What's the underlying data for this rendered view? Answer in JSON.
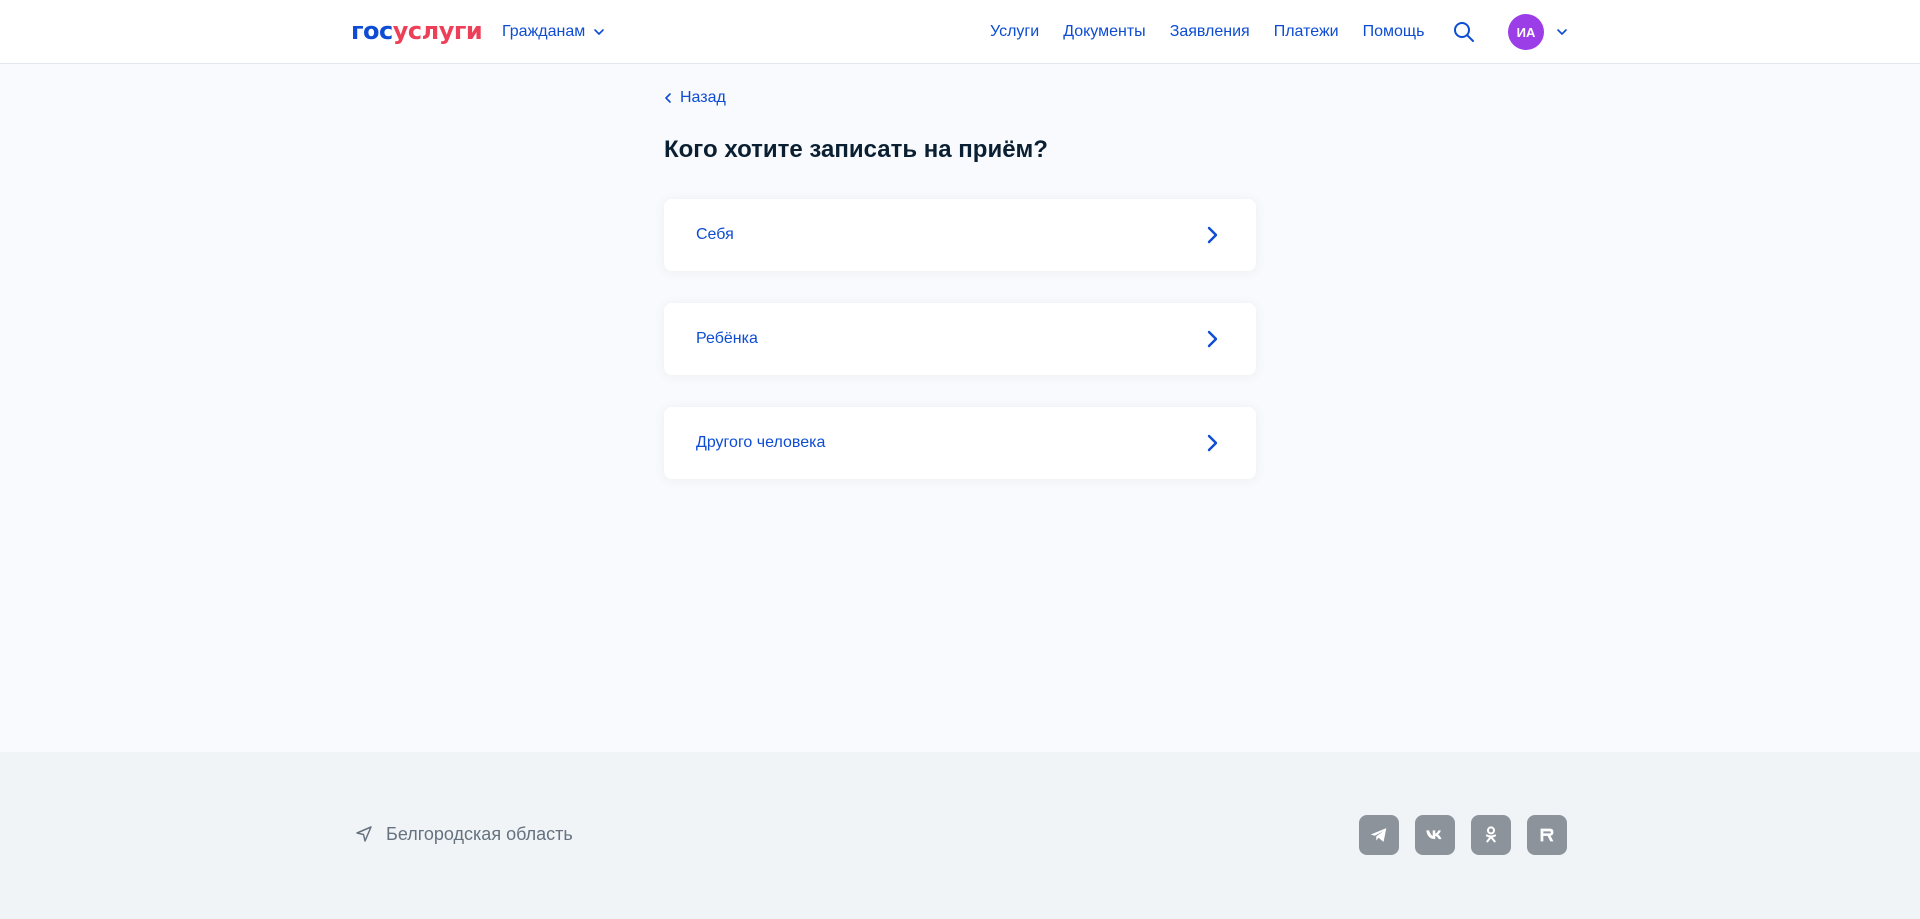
{
  "header": {
    "logo_part1": "гос",
    "logo_part2": "услуги",
    "audience_label": "Гражданам",
    "nav": [
      "Услуги",
      "Документы",
      "Заявления",
      "Платежи",
      "Помощь"
    ],
    "avatar_initials": "ИА"
  },
  "main": {
    "back_label": "Назад",
    "title": "Кого хотите записать на приём?",
    "options": [
      "Себя",
      "Ребёнка",
      "Другого человека"
    ]
  },
  "footer": {
    "region": "Белгородская область",
    "socials": [
      "telegram-icon",
      "vk-icon",
      "ok-icon",
      "rutube-icon"
    ]
  },
  "colors": {
    "accent": "#0d4cd3",
    "logo_red": "#ee3f58",
    "avatar": "#9b3ee8",
    "background": "#f8fafd",
    "footer": "#f1f4f7"
  }
}
